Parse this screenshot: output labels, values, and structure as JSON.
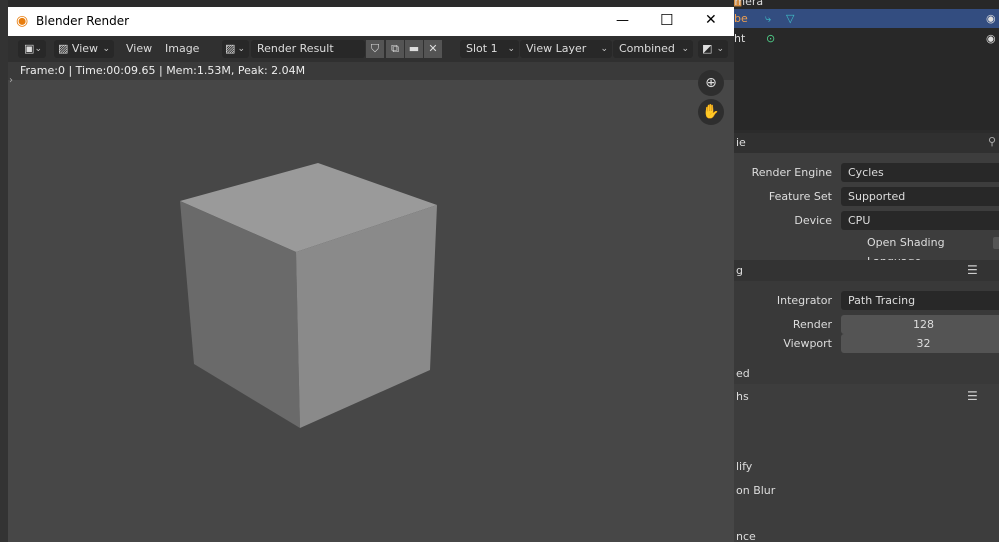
{
  "window": {
    "title": "Blender Render",
    "minimize": "—",
    "maximize": "☐",
    "close": "✕"
  },
  "header": {
    "view_menu": "View",
    "menu_view": "View",
    "menu_image": "Image",
    "image_name": "Render Result",
    "slot": "Slot 1",
    "view_layer": "View Layer",
    "pass": "Combined"
  },
  "info": "Frame:0 | Time:00:09.65 | Mem:1.53M, Peak: 2.04M",
  "outliner": {
    "rows": [
      {
        "label": "Camera"
      },
      {
        "label": "be"
      },
      {
        "label": "ht"
      }
    ]
  },
  "properties": {
    "panel_title": "ie",
    "render_engine_label": "Render Engine",
    "render_engine": "Cycles",
    "feature_set_label": "Feature Set",
    "feature_set": "Supported",
    "device_label": "Device",
    "device": "CPU",
    "osl_label": "Open Shading Language",
    "sampling_header": "g",
    "integrator_label": "Integrator",
    "integrator": "Path Tracing",
    "render_label": "Render",
    "render_samples": "128",
    "viewport_label": "Viewport",
    "viewport_samples": "32",
    "advanced": "ed",
    "light_paths": "hs",
    "simplify": "lify",
    "motion_blur": "on Blur",
    "performance": "nce"
  },
  "colors": {
    "selection": "#334d80",
    "accent_cyan": "#3fc1c9"
  }
}
